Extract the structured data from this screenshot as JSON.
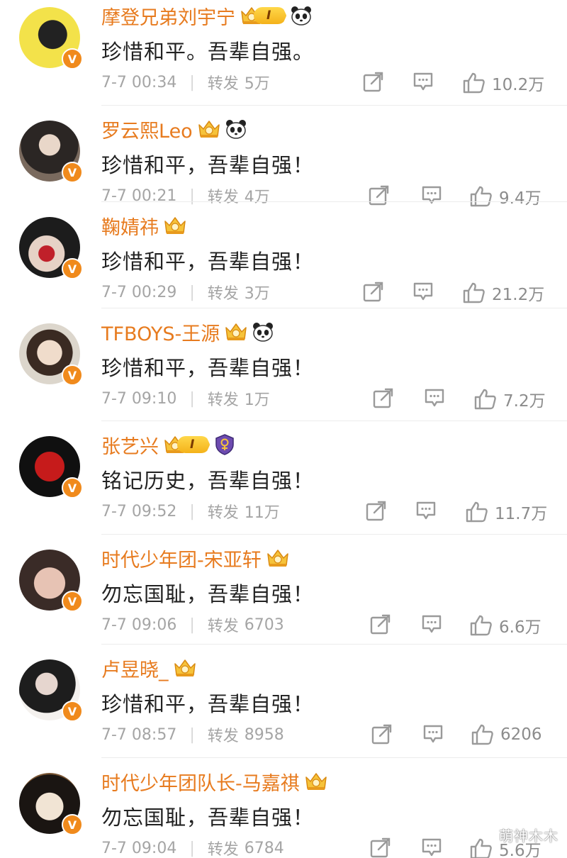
{
  "accent_color": "#e77b1f",
  "verified_badge": "V",
  "vip_level_label": "I",
  "watermark": "萌神木木",
  "icons": {
    "forward": "share-box-icon",
    "comment": "comment-icon",
    "like": "thumbs-up-icon",
    "crown": "crown-badge-icon",
    "panda": "panda-icon",
    "shield": "shield-badge-icon"
  },
  "posts": [
    {
      "name": "摩登兄弟刘宇宁",
      "badges": [
        "vip-crown",
        "panda"
      ],
      "content": "珍惜和平。吾辈自强。",
      "time": "7-7 00:34",
      "repost_label": "转发",
      "repost_count": "5万",
      "likes": "10.2万"
    },
    {
      "name": "罗云熙Leo",
      "badges": [
        "crown",
        "panda"
      ],
      "content": "珍惜和平，吾辈自强！",
      "time": "7-7 00:21",
      "repost_label": "转发",
      "repost_count": "4万",
      "likes": "9.4万"
    },
    {
      "name": "鞠婧祎",
      "badges": [
        "crown"
      ],
      "content": "珍惜和平，吾辈自强！",
      "time": "7-7 00:29",
      "repost_label": "转发",
      "repost_count": "3万",
      "likes": "21.2万"
    },
    {
      "name": "TFBOYS-王源",
      "badges": [
        "crown",
        "panda"
      ],
      "content": "珍惜和平，吾辈自强！",
      "time": "7-7 09:10",
      "repost_label": "转发",
      "repost_count": "1万",
      "likes": "7.2万"
    },
    {
      "name": "张艺兴",
      "badges": [
        "vip-crown",
        "shield"
      ],
      "content": "铭记历史，吾辈自强！",
      "time": "7-7 09:52",
      "repost_label": "转发",
      "repost_count": "11万",
      "likes": "11.7万"
    },
    {
      "name": "时代少年团-宋亚轩",
      "badges": [
        "crown"
      ],
      "content": "勿忘国耻，吾辈自强！",
      "time": "7-7 09:06",
      "repost_label": "转发",
      "repost_count": "6703",
      "likes": "6.6万"
    },
    {
      "name": "卢昱晓_",
      "badges": [
        "crown"
      ],
      "content": "珍惜和平，吾辈自强！",
      "time": "7-7 08:57",
      "repost_label": "转发",
      "repost_count": "8958",
      "likes": "6206"
    },
    {
      "name": "时代少年团队长-马嘉祺",
      "badges": [
        "crown"
      ],
      "content": "勿忘国耻，吾辈自强！",
      "time": "7-7 09:04",
      "repost_label": "转发",
      "repost_count": "6784",
      "likes": "5.6万"
    }
  ]
}
